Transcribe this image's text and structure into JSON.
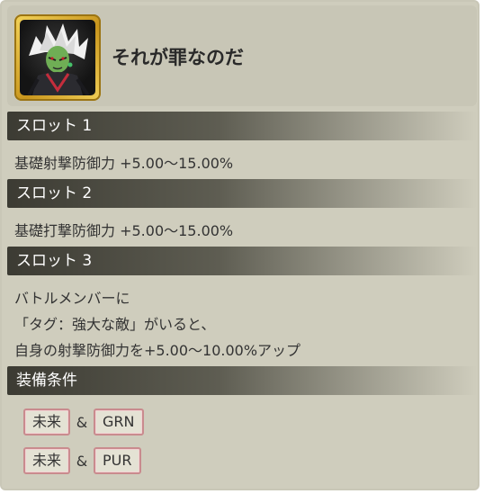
{
  "medal": {
    "title": "それが罪なのだ"
  },
  "slots": [
    {
      "label": "スロット 1",
      "effect": "基礎射撃防御力 +5.00〜15.00%"
    },
    {
      "label": "スロット 2",
      "effect": "基礎打撃防御力 +5.00〜15.00%"
    },
    {
      "label": "スロット 3",
      "lines": [
        "バトルメンバーに",
        "「タグ：強大な敵」がいると、",
        "自身の射撃防御力を+5.00〜10.00%アップ"
      ]
    }
  ],
  "conditions": {
    "label": "装備条件",
    "rows": [
      {
        "tag_a": "未来",
        "amp": "&",
        "tag_b": "GRN"
      },
      {
        "tag_a": "未来",
        "amp": "&",
        "tag_b": "PUR"
      }
    ]
  },
  "colors": {
    "panel_bg": "#cfcdbd",
    "bar_dark": "#3c3b33",
    "tag_border": "#c98b8e",
    "portrait_frame": "#e0b73a"
  }
}
